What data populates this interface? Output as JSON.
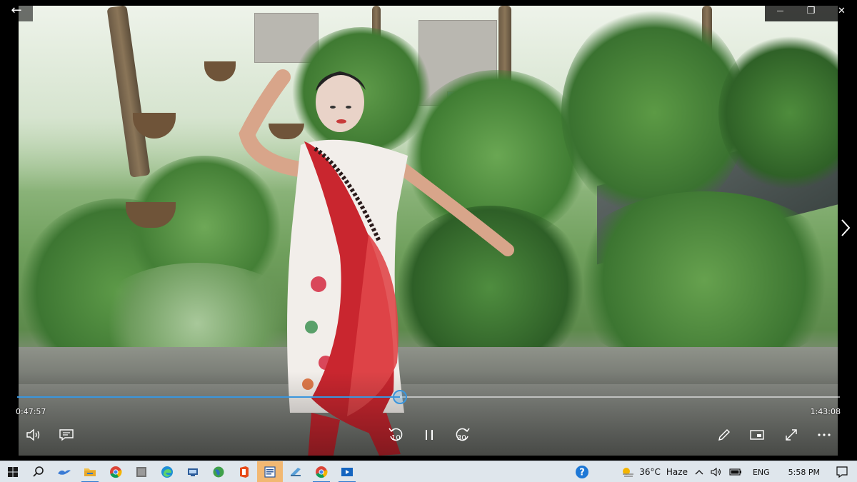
{
  "player": {
    "elapsed_time": "0:47:57",
    "total_time": "1:43:08",
    "progress_fraction": 0.4649,
    "skip_back_seconds": "10",
    "skip_forward_seconds": "30",
    "accent_color": "#3a96dd"
  },
  "window_controls": {
    "back_glyph": "←",
    "minimize_glyph": "—",
    "restore_glyph": "❐",
    "close_glyph": "✕"
  },
  "taskbar": {
    "weather_temp": "36°C",
    "weather_condition": "Haze",
    "language": "ENG",
    "clock": "5:58 PM",
    "apps": [
      "start-icon",
      "search-icon",
      "bird-app-icon",
      "file-explorer-icon",
      "chrome-icon",
      "app-icon-gray",
      "edge-icon",
      "scanner-app-icon",
      "globe-app-icon",
      "office-icon",
      "word-doc-icon",
      "notepad-icon",
      "chrome-icon",
      "movies-tv-icon"
    ]
  }
}
